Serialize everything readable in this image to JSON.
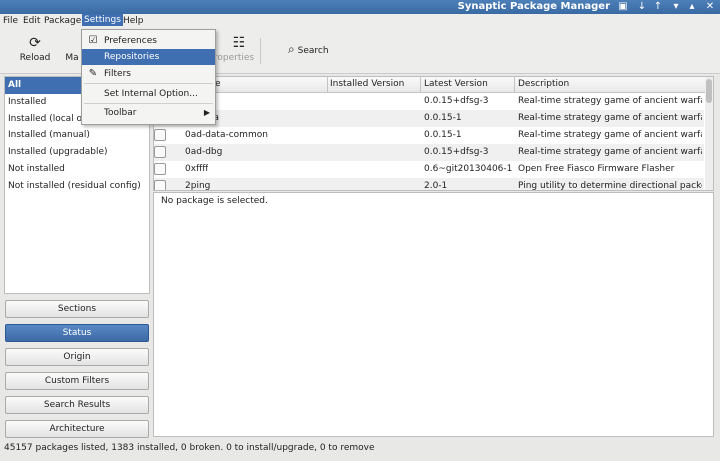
{
  "window": {
    "title": "Synaptic Package Manager"
  },
  "menubar": [
    "File",
    "Edit",
    "Package",
    "Settings",
    "Help"
  ],
  "toolbar": {
    "reload": "Reload",
    "mark": "Ma",
    "properties": "roperties",
    "search": "Search"
  },
  "filters": [
    "All",
    "Installed",
    "Installed (local or",
    "Installed (manual)",
    "Installed (upgradable)",
    "Not installed",
    "Not installed (residual config)"
  ],
  "filter_buttons": [
    "Sections",
    "Status",
    "Origin",
    "Custom Filters",
    "Search Results",
    "Architecture"
  ],
  "table": {
    "headers": {
      "name": "e",
      "installed": "Installed Version",
      "latest": "Latest Version",
      "description": "Description"
    },
    "rows": [
      {
        "name": "",
        "installed": "",
        "latest": "0.0.15+dfsg-3",
        "description": "Real-time strategy game of ancient warfare"
      },
      {
        "name": "ta",
        "installed": "",
        "latest": "0.0.15-1",
        "description": "Real-time strategy game of ancient warfare ("
      },
      {
        "name": "0ad-data-common",
        "installed": "",
        "latest": "0.0.15-1",
        "description": "Real-time strategy game of ancient warfare ("
      },
      {
        "name": "0ad-dbg",
        "installed": "",
        "latest": "0.0.15+dfsg-3",
        "description": "Real-time strategy game of ancient warfare ("
      },
      {
        "name": "0xffff",
        "installed": "",
        "latest": "0.6~git20130406-1",
        "description": "Open Free Fiasco Firmware Flasher"
      },
      {
        "name": "2ping",
        "installed": "",
        "latest": "2.0-1",
        "description": "Ping utility to determine directional packet lo"
      }
    ]
  },
  "details": {
    "text": "No package is selected."
  },
  "statusbar": {
    "text": "45157 packages listed, 1383 installed, 0 broken. 0 to install/upgrade, 0 to remove"
  },
  "settings_menu": {
    "items": [
      "Preferences",
      "Repositories",
      "Filters",
      "Set Internal Option...",
      "Toolbar"
    ]
  },
  "colors": {
    "selection": "#3f6fb0",
    "titlebar": "#4d7fb8"
  }
}
